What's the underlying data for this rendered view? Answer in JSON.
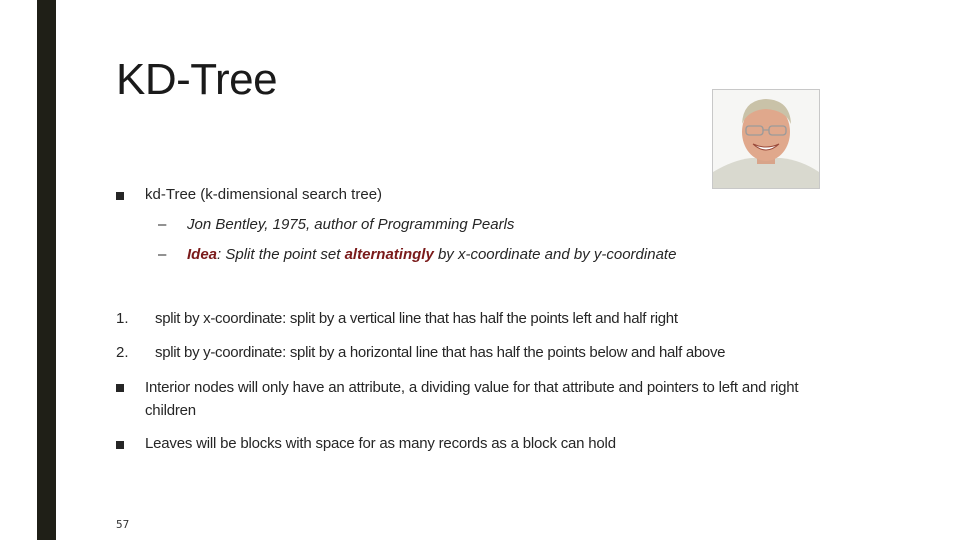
{
  "slide": {
    "title": "KD-Tree",
    "page_number": "57",
    "photo": {
      "alt": "Portrait of Jon Bentley"
    },
    "colors": {
      "side_bar": "#1f1f17",
      "emphasis": "#7a1a1a",
      "text": "#262626"
    }
  },
  "bullets": [
    {
      "marker": "square",
      "text": "kd-Tree (k-dimensional search tree)"
    }
  ],
  "sub_bullets": [
    {
      "marker": "–",
      "text": "Jon Bentley, 1975, author of Programming Pearls"
    },
    {
      "marker": "–",
      "parts": {
        "idea": "Idea",
        "t1": ": Split the point set ",
        "alt": "alternatingly",
        "t2": " by x-coordinate and by y-coordinate"
      }
    }
  ],
  "numbered": [
    {
      "marker": "1.",
      "text": "split by x-coordinate: split by a vertical line that has half the points left and half right"
    },
    {
      "marker": "2.",
      "text": "split by y-coordinate: split by a horizontal line that has half the points below and half above"
    }
  ],
  "more_bullets": [
    {
      "marker": "square",
      "text": "Interior nodes will only have an attribute, a dividing value for that attribute and pointers to left and right children"
    },
    {
      "marker": "square",
      "text": "Leaves will be blocks with space for as many records as a block can hold"
    }
  ]
}
